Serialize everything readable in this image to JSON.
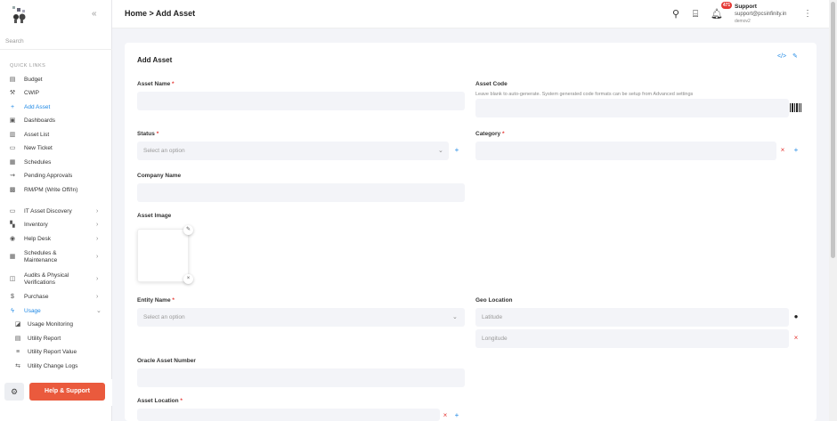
{
  "sidebar": {
    "search_placeholder": "Search",
    "section_label": "QUICK LINKS",
    "items": [
      {
        "label": "Budget",
        "icon": "file-icon"
      },
      {
        "label": "CWIP",
        "icon": "hammer-icon"
      },
      {
        "label": "Add Asset",
        "icon": "plus-icon"
      },
      {
        "label": "Dashboards",
        "icon": "dashboard-icon"
      },
      {
        "label": "Asset List",
        "icon": "chart-icon"
      },
      {
        "label": "New Ticket",
        "icon": "ticket-icon"
      },
      {
        "label": "Schedules",
        "icon": "calendar-icon"
      },
      {
        "label": "Pending Approvals",
        "icon": "approval-icon"
      },
      {
        "label": "RM/PM (Write Off/In)",
        "icon": "box-icon"
      },
      {
        "label": "IT Asset Discovery",
        "icon": "laptop-icon"
      },
      {
        "label": "Inventory",
        "icon": "inventory-icon"
      },
      {
        "label": "Help Desk",
        "icon": "help-icon"
      },
      {
        "label": "Schedules & Maintenance",
        "icon": "schedule-icon"
      },
      {
        "label": "Audits & Physical Verifications",
        "icon": "audit-icon"
      },
      {
        "label": "Purchase",
        "icon": "dollar-icon"
      },
      {
        "label": "Usage",
        "icon": "bolt-icon"
      }
    ],
    "sub_items": [
      {
        "label": "Usage Monitoring",
        "icon": "monitor-icon"
      },
      {
        "label": "Utility Report",
        "icon": "report-icon"
      },
      {
        "label": "Utility Report Value",
        "icon": "list-icon"
      },
      {
        "label": "Utility Change Logs",
        "icon": "log-icon"
      }
    ],
    "help_label": "Help & Support"
  },
  "header": {
    "breadcrumb": "Home > Add Asset",
    "notification_count": "471",
    "user_name": "Support",
    "user_email": "support@pcsinfinity.in",
    "user_sub": "demov2"
  },
  "form": {
    "title": "Add Asset",
    "asset_name_label": "Asset Name",
    "asset_code_label": "Asset Code",
    "asset_code_hint": "Leave blank to auto-generate. System generated code formats can be setup from Advanced settings",
    "status_label": "Status",
    "status_placeholder": "Select an option",
    "category_label": "Category",
    "company_name_label": "Company Name",
    "asset_image_label": "Asset Image",
    "entity_name_label": "Entity Name",
    "entity_placeholder": "Select an option",
    "geo_location_label": "Geo Location",
    "latitude_placeholder": "Latitude",
    "longitude_placeholder": "Longitude",
    "oracle_label": "Oracle Asset Number",
    "asset_location_label": "Asset Location",
    "required_mark": "*"
  }
}
